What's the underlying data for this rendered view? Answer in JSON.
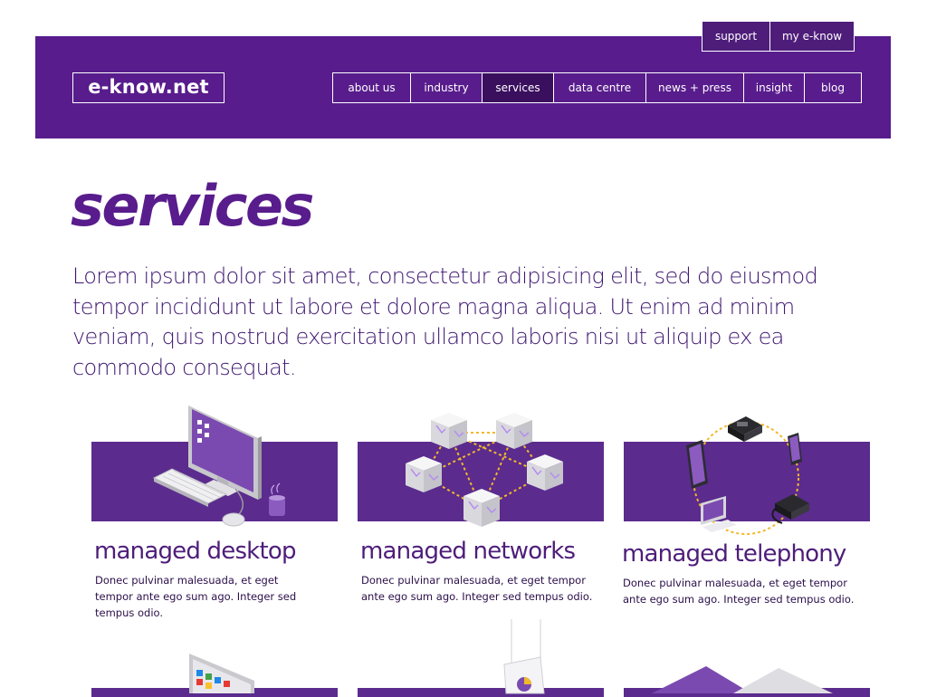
{
  "header": {
    "logo": "e-know.net",
    "top_links": [
      "support",
      "my e-know"
    ],
    "nav": [
      {
        "label": "about us",
        "active": false
      },
      {
        "label": "industry",
        "active": false
      },
      {
        "label": "services",
        "active": true
      },
      {
        "label": "data centre",
        "active": false
      },
      {
        "label": "news + press",
        "active": false
      },
      {
        "label": "insight",
        "active": false
      },
      {
        "label": "blog",
        "active": false
      }
    ]
  },
  "page": {
    "title": "services",
    "intro": "Lorem ipsum dolor sit amet, consectetur adipisicing elit, sed do eiusmod tempor incididunt ut labore et dolore magna aliqua. Ut enim ad minim veniam, quis nostrud exercitation ullamco laboris nisi ut aliquip ex ea commodo consequat."
  },
  "services": [
    {
      "title": "managed desktop",
      "description": "Donec pulvinar malesuada, et eget tempor ante ego sum ago. Integer sed tempus odio."
    },
    {
      "title": "managed networks",
      "description": "Donec pulvinar malesuada, et eget tempor ante ego sum ago. Integer sed tempus odio."
    },
    {
      "title": "managed telephony",
      "description": "Donec pulvinar malesuada, et eget tempor ante ego sum ago. Integer sed tempus odio."
    }
  ],
  "colors": {
    "brand_purple": "#581c8c",
    "band_purple": "#5b2b8e",
    "active_nav": "#3a0f5e",
    "accent_yellow": "#f2b829"
  }
}
